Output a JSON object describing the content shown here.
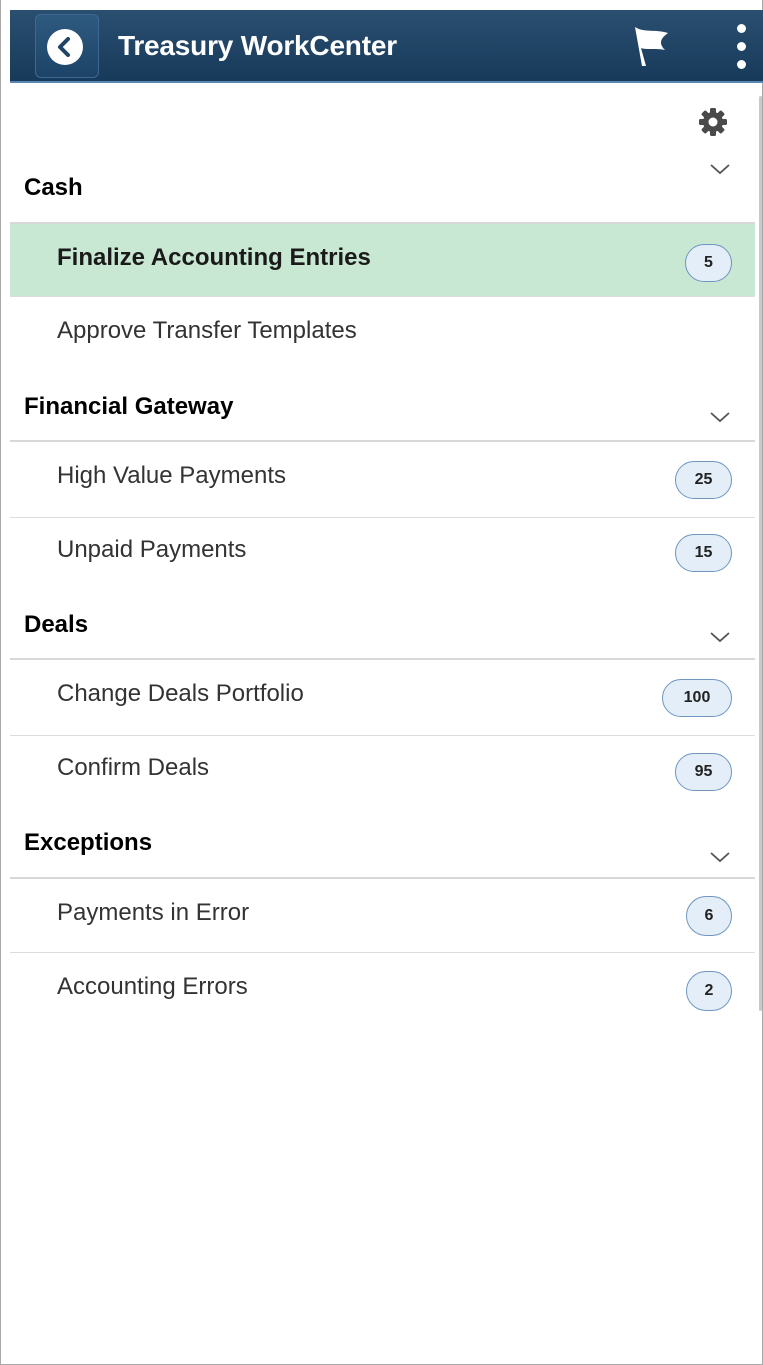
{
  "header": {
    "title": "Treasury WorkCenter",
    "back_icon": "back-chevron-icon",
    "flag_icon": "flag-icon",
    "menu_icon": "vertical-dots-icon"
  },
  "settings_icon": "gear-icon",
  "sections": [
    {
      "title": "Cash",
      "items": [
        {
          "label": "Finalize Accounting Entries",
          "count": "5",
          "selected": true
        },
        {
          "label": "Approve Transfer Templates",
          "count": ""
        }
      ]
    },
    {
      "title": "Financial Gateway",
      "items": [
        {
          "label": "High Value Payments",
          "count": "25"
        },
        {
          "label": "Unpaid Payments",
          "count": "15"
        }
      ]
    },
    {
      "title": "Deals",
      "items": [
        {
          "label": "Change Deals Portfolio",
          "count": "100"
        },
        {
          "label": "Confirm Deals",
          "count": "95"
        }
      ]
    },
    {
      "title": "Exceptions",
      "items": [
        {
          "label": "Payments in Error",
          "count": "6"
        },
        {
          "label": "Accounting Errors",
          "count": "2"
        }
      ]
    }
  ],
  "colors": {
    "header": "#1f4466",
    "selected_row": "#c8e8d3",
    "badge_border": "#6d96c0",
    "badge_fill": "#e4eef8"
  }
}
